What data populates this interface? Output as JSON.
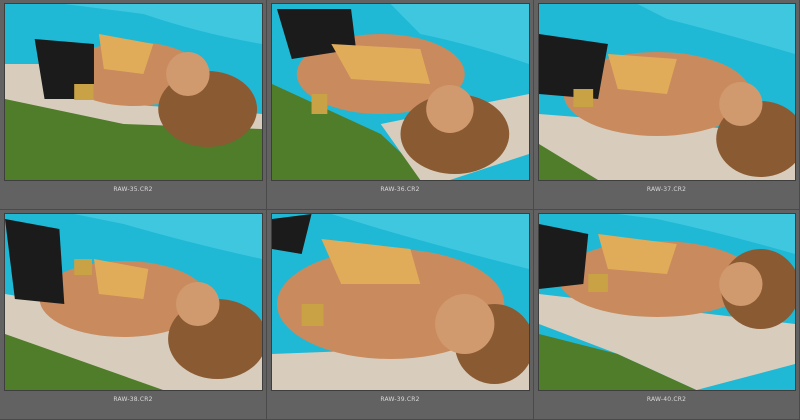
{
  "colors": {
    "pool": "#1fb9d6",
    "pool_light": "#5fd5ea",
    "grass": "#4f7d2a",
    "deck": "#d8cdbd",
    "skin": "#c98a5e",
    "hair": "#8a5a33",
    "bikini": "#1b1b1b",
    "gold": "#e1ac5a",
    "panel": "#626262"
  },
  "photos": [
    {
      "filename": "RAW-35.CR2",
      "icon": "photo-thumbnail"
    },
    {
      "filename": "RAW-36.CR2",
      "icon": "photo-thumbnail"
    },
    {
      "filename": "RAW-37.CR2",
      "icon": "photo-thumbnail"
    },
    {
      "filename": "RAW-38.CR2",
      "icon": "photo-thumbnail"
    },
    {
      "filename": "RAW-39.CR2",
      "icon": "photo-thumbnail"
    },
    {
      "filename": "RAW-40.CR2",
      "icon": "photo-thumbnail"
    }
  ]
}
